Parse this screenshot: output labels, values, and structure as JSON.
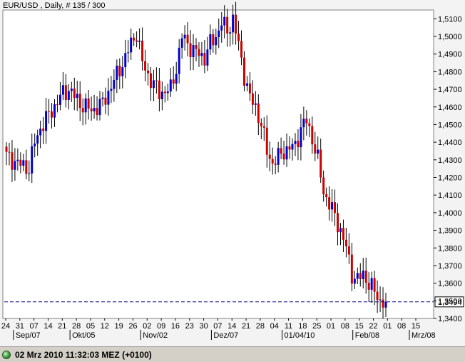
{
  "header": {
    "title": "EUR/USD , Daily, # 135 / 300"
  },
  "status": {
    "text": "02 Mrz 2010 11:32:03  MEZ (+0100)",
    "icon": "green-status-icon"
  },
  "colors": {
    "up": "#0000cc",
    "down": "#cc0000",
    "wick": "#000000",
    "current_line": "#00007f",
    "background": "#ffffff"
  },
  "chart_data": {
    "type": "candlestick",
    "title": "EUR/USD , Daily, # 135 / 300",
    "ylim": [
      1.34,
      1.515
    ],
    "y_ticks": [
      "1,5100",
      "1,5000",
      "1,4900",
      "1,4800",
      "1,4700",
      "1,4600",
      "1,4500",
      "1,4400",
      "1,4300",
      "1,4200",
      "1,4100",
      "1,4000",
      "1,3900",
      "1,3800",
      "1,3700",
      "1,3600",
      "1,3500",
      "1,3400"
    ],
    "current_price": 1.3494,
    "current_price_label": "1,3494",
    "x_day_labels": [
      "24",
      "31",
      "07",
      "14",
      "21",
      "28",
      "05",
      "12",
      "19",
      "26",
      "02",
      "09",
      "16",
      "23",
      "30",
      "07",
      "14",
      "21",
      "28",
      "04",
      "11",
      "18",
      "25",
      "01",
      "08",
      "15",
      "22",
      "01",
      "08",
      "15"
    ],
    "x_month_labels": [
      "Sep/07",
      "Okt/05",
      "Nov/02",
      "Dez/07",
      "01/04/10",
      "Feb/08",
      "Mrz/08"
    ],
    "close_anchors": [
      [
        0,
        1.432
      ],
      [
        4,
        1.428
      ],
      [
        8,
        1.425
      ],
      [
        10,
        1.44
      ],
      [
        12,
        1.448
      ],
      [
        16,
        1.458
      ],
      [
        20,
        1.468
      ],
      [
        22,
        1.47
      ],
      [
        26,
        1.462
      ],
      [
        30,
        1.458
      ],
      [
        34,
        1.462
      ],
      [
        38,
        1.475
      ],
      [
        42,
        1.488
      ],
      [
        44,
        1.496
      ],
      [
        46,
        1.502
      ],
      [
        48,
        1.485
      ],
      [
        50,
        1.478
      ],
      [
        54,
        1.468
      ],
      [
        58,
        1.47
      ],
      [
        60,
        1.482
      ],
      [
        62,
        1.5
      ],
      [
        66,
        1.492
      ],
      [
        70,
        1.488
      ],
      [
        72,
        1.496
      ],
      [
        74,
        1.5
      ],
      [
        76,
        1.508
      ],
      [
        78,
        1.503
      ],
      [
        80,
        1.51
      ],
      [
        82,
        1.495
      ],
      [
        84,
        1.478
      ],
      [
        86,
        1.465
      ],
      [
        88,
        1.46
      ],
      [
        90,
        1.45
      ],
      [
        92,
        1.435
      ],
      [
        94,
        1.428
      ],
      [
        98,
        1.435
      ],
      [
        102,
        1.438
      ],
      [
        104,
        1.448
      ],
      [
        106,
        1.452
      ],
      [
        108,
        1.442
      ],
      [
        110,
        1.43
      ],
      [
        112,
        1.412
      ],
      [
        114,
        1.405
      ],
      [
        116,
        1.398
      ],
      [
        118,
        1.39
      ],
      [
        120,
        1.38
      ],
      [
        122,
        1.365
      ],
      [
        124,
        1.362
      ],
      [
        126,
        1.365
      ],
      [
        128,
        1.36
      ],
      [
        130,
        1.355
      ],
      [
        132,
        1.35
      ],
      [
        134,
        1.3494
      ]
    ]
  }
}
